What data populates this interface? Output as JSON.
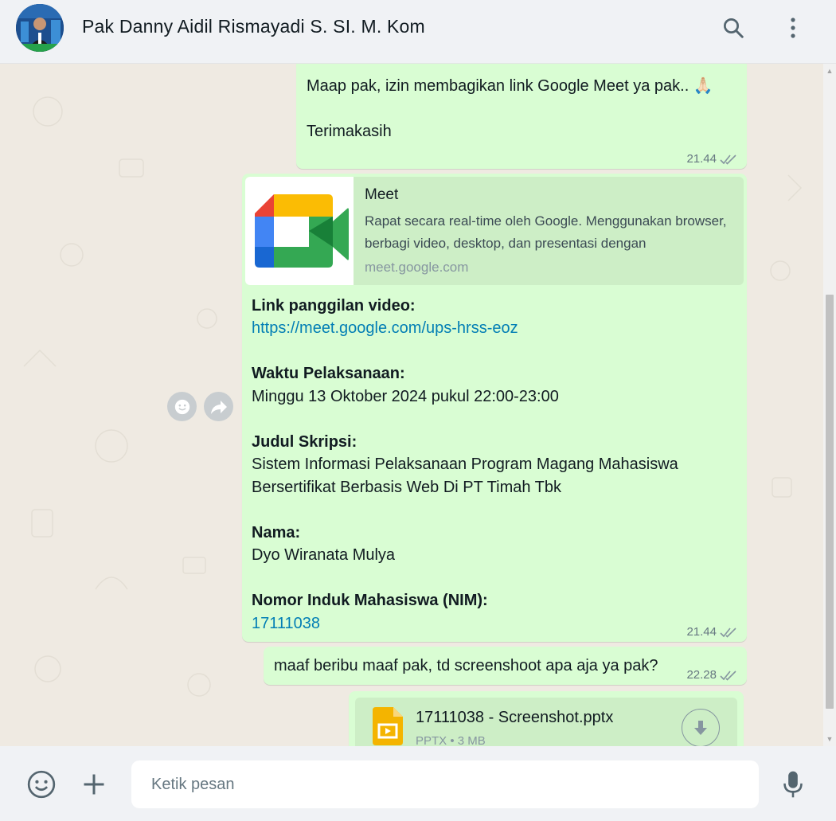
{
  "header": {
    "contact_name": "Pak Danny Aidil Rismayadi S. SI. M. Kom"
  },
  "messages": [
    {
      "partial_line": "Maap pak, izin membagikan link Google Meet ya pak.. 🙏🏻",
      "thanks": "Terimakasih",
      "time": "21.44"
    },
    {
      "preview": {
        "title": "Meet",
        "description": "Rapat secara real-time oleh Google. Menggunakan browser, berbagi video, desktop, dan presentasi dengan",
        "domain": "meet.google.com"
      },
      "link_label": "Link panggilan video:",
      "link_url": "https://meet.google.com/ups-hrss-eoz",
      "time_label": "Waktu Pelaksanaan:",
      "time_value": "Minggu 13 Oktober 2024 pukul 22:00-23:00",
      "title_label": "Judul Skripsi:",
      "title_value_1": "Sistem Informasi Pelaksanaan Program Magang Mahasiswa",
      "title_value_2": "Bersertifikat Berbasis Web Di PT Timah Tbk",
      "name_label": "Nama:",
      "name_value": "Dyo Wiranata Mulya",
      "nim_label": "Nomor Induk Mahasiswa (NIM):",
      "nim_value": "17111038",
      "time": "21.44"
    },
    {
      "text": "maaf beribu maaf pak, td screenshoot apa aja ya pak?",
      "time": "22.28"
    },
    {
      "file_name": "17111038 - Screenshot.pptx",
      "file_type": "PPTX",
      "file_size": "3 MB"
    }
  ],
  "composer": {
    "placeholder": "Ketik pesan"
  },
  "colors": {
    "outgoing_bubble": "#d9fdd3",
    "link": "#027eb5",
    "chat_bg": "#efeae2",
    "header_bg": "#f0f2f5"
  },
  "icons": [
    "search-icon",
    "menu-icon",
    "emoji-icon",
    "forward-icon",
    "attach-icon",
    "mic-icon",
    "download-icon",
    "slides-file-icon",
    "read-ticks-icon"
  ]
}
